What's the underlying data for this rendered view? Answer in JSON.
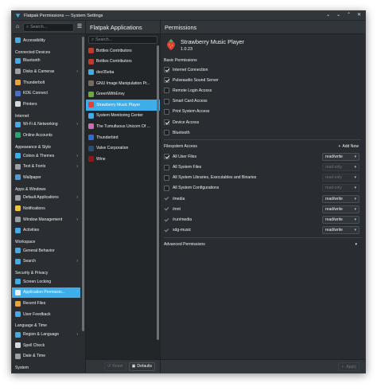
{
  "window": {
    "title": "Flatpak Permissions — System Settings",
    "controls": [
      "keep-above",
      "minimize",
      "maximize",
      "close"
    ]
  },
  "sidebar": {
    "search_placeholder": "Search...",
    "items": [
      {
        "type": "item",
        "label": "Accessibility",
        "icon": "accessibility-icon",
        "color": "#3daee9"
      },
      {
        "type": "category",
        "label": "Connected Devices"
      },
      {
        "type": "item",
        "label": "Bluetooth",
        "icon": "bluetooth-icon",
        "color": "#3daee9"
      },
      {
        "type": "item",
        "label": "Disks & Cameras",
        "icon": "disks-icon",
        "color": "#9b9fa4",
        "arrow": true
      },
      {
        "type": "item",
        "label": "Thunderbolt",
        "icon": "thunderbolt-icon",
        "color": "#e8a33b"
      },
      {
        "type": "item",
        "label": "KDE Connect",
        "icon": "kde-connect-icon",
        "color": "#4a6fc9"
      },
      {
        "type": "item",
        "label": "Printers",
        "icon": "printer-icon",
        "color": "#d6d8da"
      },
      {
        "type": "category",
        "label": "Internet"
      },
      {
        "type": "item",
        "label": "Wi-Fi & Networking",
        "icon": "wifi-icon",
        "color": "#3daee9",
        "arrow": true
      },
      {
        "type": "item",
        "label": "Online Accounts",
        "icon": "online-accounts-icon",
        "color": "#2ba56d"
      },
      {
        "type": "category",
        "label": "Appearance & Style"
      },
      {
        "type": "item",
        "label": "Colors & Themes",
        "icon": "colors-icon",
        "color": "#3daee9",
        "arrow": true
      },
      {
        "type": "item",
        "label": "Text & Fonts",
        "icon": "fonts-icon",
        "color": "#9b9fa4",
        "arrow": true
      },
      {
        "type": "item",
        "label": "Wallpaper",
        "icon": "wallpaper-icon",
        "color": "#4d9ed8"
      },
      {
        "type": "category",
        "label": "Apps & Windows"
      },
      {
        "type": "item",
        "label": "Default Applications",
        "icon": "default-apps-icon",
        "color": "#9b9fa4",
        "arrow": true
      },
      {
        "type": "item",
        "label": "Notifications",
        "icon": "notifications-icon",
        "color": "#f0c433"
      },
      {
        "type": "item",
        "label": "Window Management",
        "icon": "window-management-icon",
        "color": "#9b9fa4",
        "arrow": true
      },
      {
        "type": "item",
        "label": "Activities",
        "icon": "activities-icon",
        "color": "#3daee9"
      },
      {
        "type": "category",
        "label": "Workspace"
      },
      {
        "type": "item",
        "label": "General Behavior",
        "icon": "general-behavior-icon",
        "color": "#3daee9"
      },
      {
        "type": "item",
        "label": "Search",
        "icon": "search-icon",
        "color": "#3daee9",
        "arrow": true
      },
      {
        "type": "category",
        "label": "Security & Privacy"
      },
      {
        "type": "item",
        "label": "Screen Locking",
        "icon": "screen-locking-icon",
        "color": "#3daee9"
      },
      {
        "type": "item",
        "label": "Application Permissio...",
        "icon": "app-permissions-icon",
        "color": "#eff0f1",
        "arrow": true,
        "selected": true
      },
      {
        "type": "item",
        "label": "Recent Files",
        "icon": "recent-files-icon",
        "color": "#e8a33b"
      },
      {
        "type": "item",
        "label": "User Feedback",
        "icon": "user-feedback-icon",
        "color": "#3daee9"
      },
      {
        "type": "category",
        "label": "Language & Time"
      },
      {
        "type": "item",
        "label": "Region & Language",
        "icon": "region-icon",
        "color": "#3daee9",
        "arrow": true
      },
      {
        "type": "item",
        "label": "Spell Check",
        "icon": "spell-check-icon",
        "color": "#d6d8da"
      },
      {
        "type": "item",
        "label": "Date & Time",
        "icon": "date-time-icon",
        "color": "#9b9fa4"
      },
      {
        "type": "category",
        "label": "System"
      }
    ]
  },
  "apps": {
    "header": "Flatpak Applications",
    "search_placeholder": "Search...",
    "items": [
      {
        "label": "Bottles Contributors",
        "icon": "bottles-icon",
        "color": "#c0392b"
      },
      {
        "label": "Bottles Contributors",
        "icon": "bottles-icon",
        "color": "#c0392b"
      },
      {
        "label": "dec05eba",
        "icon": "dec05eba-icon",
        "color": "#3daee9"
      },
      {
        "label": "GNU Image Manipulation Pr...",
        "icon": "gimp-icon",
        "color": "#7a6a58"
      },
      {
        "label": "GreenWithEnvy",
        "icon": "greenwithenvy-icon",
        "color": "#6aab3c"
      },
      {
        "label": "Strawberry Music Player",
        "icon": "strawberry-icon",
        "color": "#e0403a",
        "selected": true
      },
      {
        "label": "System Monitoring Center",
        "icon": "monitoring-icon",
        "color": "#3daee9"
      },
      {
        "label": "The Tumultuous Unicorn Of ...",
        "icon": "unicorn-icon",
        "color": "#d16ab5"
      },
      {
        "label": "Thunderbird",
        "icon": "thunderbird-icon",
        "color": "#2d6bd6"
      },
      {
        "label": "Valve Corporation",
        "icon": "steam-icon",
        "color": "#2a4c7a"
      },
      {
        "label": "Wine",
        "icon": "wine-icon",
        "color": "#8b1a1a"
      }
    ],
    "footer": {
      "reset": "Reset",
      "defaults": "Defaults"
    }
  },
  "permissions": {
    "header": "Permissions",
    "app_name": "Strawberry Music Player",
    "app_version": "1.0.23",
    "basic_title": "Basic Permissions",
    "basic": [
      {
        "label": "Internet Connection",
        "checked": true
      },
      {
        "label": "Pulseaudio Sound Server",
        "checked": true
      },
      {
        "label": "Remote Login Access",
        "checked": false
      },
      {
        "label": "Smart Card Access",
        "checked": false
      },
      {
        "label": "Print System Access",
        "checked": false
      },
      {
        "label": "Device Access",
        "checked": true
      },
      {
        "label": "Bluetooth",
        "checked": false
      }
    ],
    "filesystem_title": "Filesystem Access",
    "add_new": "Add New",
    "filesystem": [
      {
        "label": "All User Files",
        "state": "checked",
        "mode": "read/write",
        "enabled": true
      },
      {
        "label": "All System Files",
        "state": "unchecked",
        "mode": "read-only",
        "enabled": false
      },
      {
        "label": "All System Libraries, Executables and Binaries",
        "state": "unchecked",
        "mode": "read-only",
        "enabled": false
      },
      {
        "label": "All System Configurations",
        "state": "unchecked",
        "mode": "read-only",
        "enabled": false
      },
      {
        "label": "/media",
        "state": "tick",
        "mode": "read/write",
        "enabled": true
      },
      {
        "label": "/mnt",
        "state": "tick",
        "mode": "read/write",
        "enabled": true
      },
      {
        "label": "/run/media",
        "state": "tick",
        "mode": "read/write",
        "enabled": true
      },
      {
        "label": "xdg-music",
        "state": "tick",
        "mode": "read/write",
        "enabled": true
      }
    ],
    "advanced_title": "Advanced Permissions",
    "apply": "Apply"
  }
}
